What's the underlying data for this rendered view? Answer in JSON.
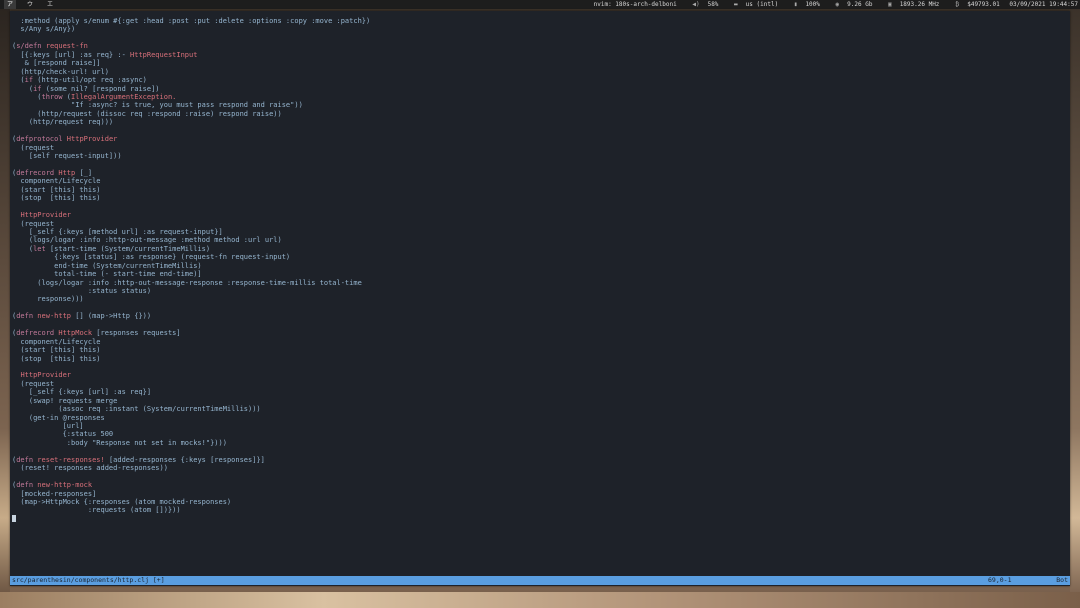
{
  "topbar": {
    "workspaces": [
      "ア",
      "ウ",
      "エ"
    ],
    "window_title": "nvim: 180s-arch-delboni",
    "volume": "58%",
    "keyboard": "us (intl)",
    "battery": "100%",
    "memory": "9.26 Gb",
    "cpu_freq": "1893.26 MHz",
    "btc": "$49793.01",
    "datetime": "03/09/2021 19:44:57"
  },
  "editor": {
    "lines": [
      "  :method (apply s/enum #{:get :head :post :put :delete :options :copy :move :patch})",
      "  s/Any s/Any})",
      "",
      "(s/defn request-fn",
      "  [{:keys [url] :as req} :- HttpRequestInput",
      "   & [respond raise]]",
      "  (http/check-url! url)",
      "  (if (http-util/opt req :async)",
      "    (if (some nil? [respond raise])",
      "      (throw (IllegalArgumentException.",
      "              \"If :async? is true, you must pass respond and raise\"))",
      "      (http/request (dissoc req :respond :raise) respond raise))",
      "    (http/request req)))",
      "",
      "(defprotocol HttpProvider",
      "  (request",
      "    [self request-input]))",
      "",
      "(defrecord Http [_]",
      "  component/Lifecycle",
      "  (start [this] this)",
      "  (stop  [this] this)",
      "",
      "  HttpProvider",
      "  (request",
      "    [_self {:keys [method url] :as request-input}]",
      "    (logs/logar :info :http-out-message :method method :url url)",
      "    (let [start-time (System/currentTimeMillis)",
      "          {:keys [status] :as response} (request-fn request-input)",
      "          end-time (System/currentTimeMillis)",
      "          total-time (- start-time end-time)]",
      "      (logs/logar :info :http-out-message-response :response-time-millis total-time",
      "                  :status status)",
      "      response)))",
      "",
      "(defn new-http [] (map->Http {}))",
      "",
      "(defrecord HttpMock [responses requests]",
      "  component/Lifecycle",
      "  (start [this] this)",
      "  (stop  [this] this)",
      "",
      "  HttpProvider",
      "  (request",
      "    [_self {:keys [url] :as req}]",
      "    (swap! requests merge",
      "           (assoc req :instant (System/currentTimeMillis)))",
      "    (get-in @responses",
      "            [url]",
      "            {:status 500",
      "             :body \"Response not set in mocks!\"})))",
      "",
      "(defn reset-responses! [added-responses {:keys [responses]}]",
      "  (reset! responses added-responses))",
      "",
      "(defn new-http-mock",
      "  [mocked-responses]",
      "  (map->HttpMock {:responses (atom mocked-responses)",
      "                  :requests (atom [])}))",
      ""
    ]
  },
  "statusline": {
    "file": "src/parenthesin/components/http.clj  [+]",
    "position": "69,0-1",
    "percent": "Bot"
  }
}
